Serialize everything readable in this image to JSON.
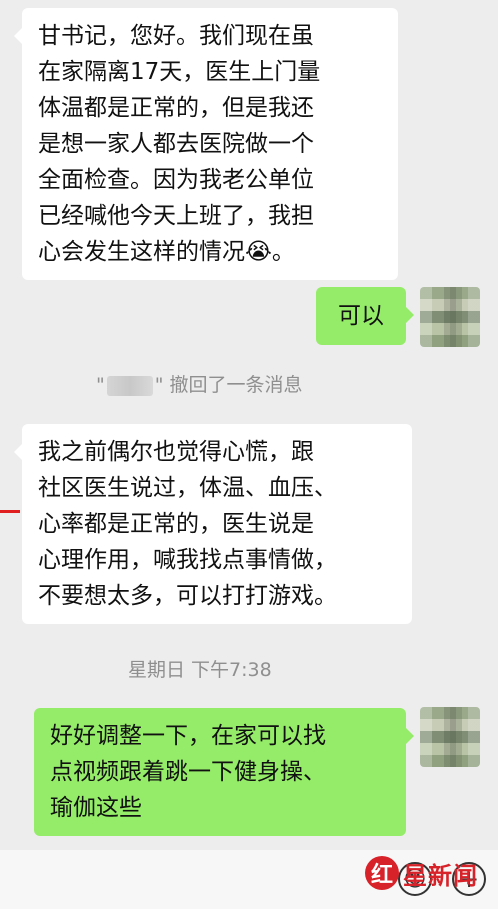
{
  "messages": [
    {
      "side": "in",
      "text": "甘书记，您好。我们现在虽\n在家隔离17天，医生上门量\n体温都是正常的，但是我还\n是想一家人都去医院做一个\n全面检查。因为我老公单位\n已经喊他今天上班了，我担\n心会发生这样的情况😭。"
    },
    {
      "side": "out",
      "text": "可以"
    },
    {
      "side": "in",
      "text": "我之前偶尔也觉得心慌，跟\n社区医生说过，体温、血压、\n心率都是正常的，医生说是\n心理作用，喊我找点事情做，\n不要想太多，可以打打游戏。"
    },
    {
      "side": "out",
      "text": "好好调整一下，在家可以找\n点视频跟着跳一下健身操、\n瑜伽这些"
    }
  ],
  "system": {
    "recall_prefix": "\"",
    "recall_suffix": "\" 撤回了一条消息",
    "timestamp": "星期日 下午7:38"
  },
  "watermark": {
    "logo_char": "红",
    "text": "星新闻"
  },
  "toolbar": {
    "emoji_glyph": "☺",
    "plus_glyph": "+"
  },
  "colors": {
    "background": "#ededed",
    "incoming_bubble": "#ffffff",
    "outgoing_bubble": "#95ec69",
    "watermark_red": "#d8222a"
  }
}
